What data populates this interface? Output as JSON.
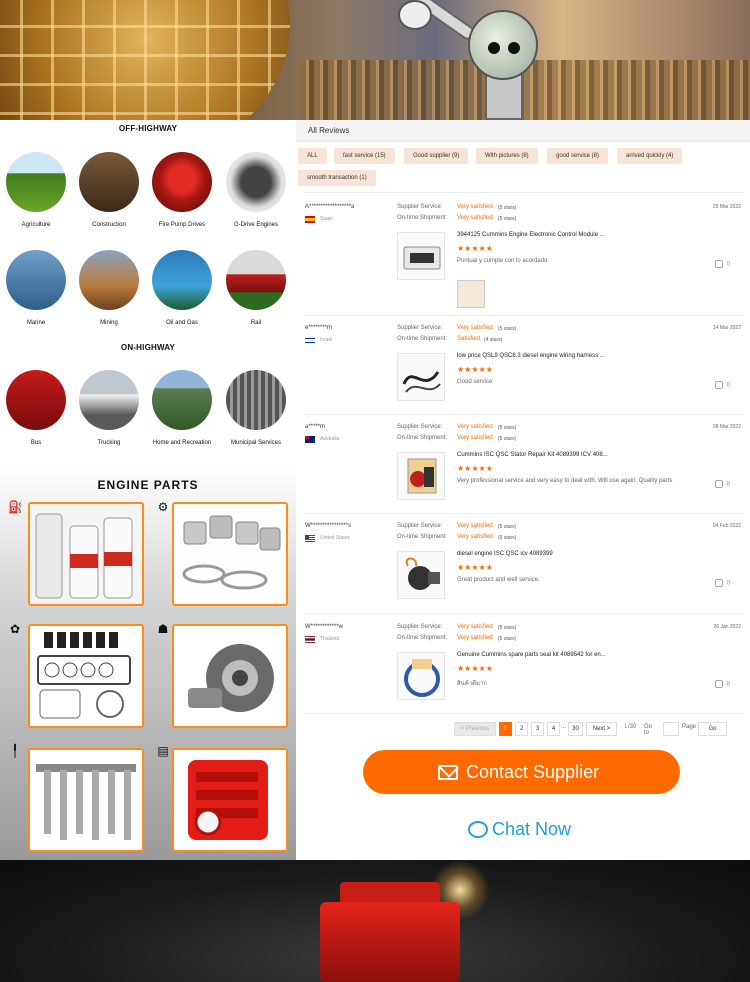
{
  "sections": {
    "off_highway": "OFF-HIGHWAY",
    "on_highway": "ON-HIGHWAY",
    "engine_parts": "ENGINE PARTS"
  },
  "off_highway_items": [
    {
      "label": "Agriculture"
    },
    {
      "label": "Construction"
    },
    {
      "label": "Fire Pump Drives"
    },
    {
      "label": "G-Drive Engines"
    },
    {
      "label": "Marine"
    },
    {
      "label": "Mining"
    },
    {
      "label": "Oil and Gas"
    },
    {
      "label": "Rail"
    }
  ],
  "on_highway_items": [
    {
      "label": "Bus"
    },
    {
      "label": "Trucking"
    },
    {
      "label": "Home and Recreation"
    },
    {
      "label": "Municipal Services"
    }
  ],
  "reviews": {
    "header": "All Reviews",
    "tags": [
      "ALL",
      "fast service (15)",
      "Good supplier (9)",
      "With pictures (8)",
      "good service (8)",
      "arrived quickly (4)",
      "smooth transaction (1)"
    ],
    "supplier_label": "Supplier Service:",
    "shipment_label": "On-time Shipment:",
    "items": [
      {
        "user": "A******************a",
        "country": "Spain",
        "date": "25 Mar 2022",
        "supplier_val": "Very satisfied",
        "supplier_stars": "(5 stars)",
        "shipment_val": "Very satisfied",
        "shipment_stars": "(5 stars)",
        "title": "3944125 Cummins Engine Electronic Control Module ...",
        "stars": "★★★★★",
        "text": "Puntual y cumple con lo acordado",
        "likes": "0"
      },
      {
        "user": "e********m",
        "country": "Israel",
        "date": "14 Mar 2022",
        "supplier_val": "Very satisfied",
        "supplier_stars": "(5 stars)",
        "shipment_val": "Satisfied",
        "shipment_stars": "(4 stars)",
        "title": "low price QSL9 QSC8.3 diesel engine wiring harness ...",
        "stars": "★★★★★",
        "text": "Good service",
        "likes": "0"
      },
      {
        "user": "a*****m",
        "country": "Australia",
        "date": "08 Mar 2022",
        "supplier_val": "Very satisfied",
        "supplier_stars": "(5 stars)",
        "shipment_val": "Very satisfied",
        "shipment_stars": "(5 stars)",
        "title": "Cummins ISC QSC Stator Repair Kit 4089399 ICV 408...",
        "stars": "★★★★★",
        "text": "Very professional service and very easy to deal with. Will use again. Quality parts",
        "likes": "0"
      },
      {
        "user": "W****************s",
        "country": "United States",
        "date": "04 Feb 2022",
        "supplier_val": "Very satisfied",
        "supplier_stars": "(5 stars)",
        "shipment_val": "Very satisfied",
        "shipment_stars": "(5 stars)",
        "title": "diesel engine ISC QSC icv 4089399",
        "stars": "★★★★★",
        "text": "Great product and well service.",
        "likes": "0"
      },
      {
        "user": "W************w",
        "country": "Thailand",
        "date": "26 Jan 2022",
        "supplier_val": "Very satisfied",
        "supplier_stars": "(5 stars)",
        "shipment_val": "Very satisfied",
        "shipment_stars": "(5 stars)",
        "title": "Genuine Cummins spare parts seal kit 4089542 for en...",
        "stars": "★★★★★",
        "text": "สินค้าดีมาก",
        "likes": "0"
      }
    ]
  },
  "pagination": {
    "prev": "< Previous",
    "pages": [
      "1",
      "2",
      "3",
      "4",
      "...",
      "30"
    ],
    "next": "Next >",
    "current": "1",
    "total": "/30",
    "goto": "Go to",
    "page": "Page",
    "go": "Go"
  },
  "actions": {
    "contact": "Contact Supplier",
    "chat": "Chat Now"
  },
  "colors": {
    "accent": "#ff6a00",
    "chat": "#1ea0d8",
    "tag_bg": "#f7e4d7"
  }
}
